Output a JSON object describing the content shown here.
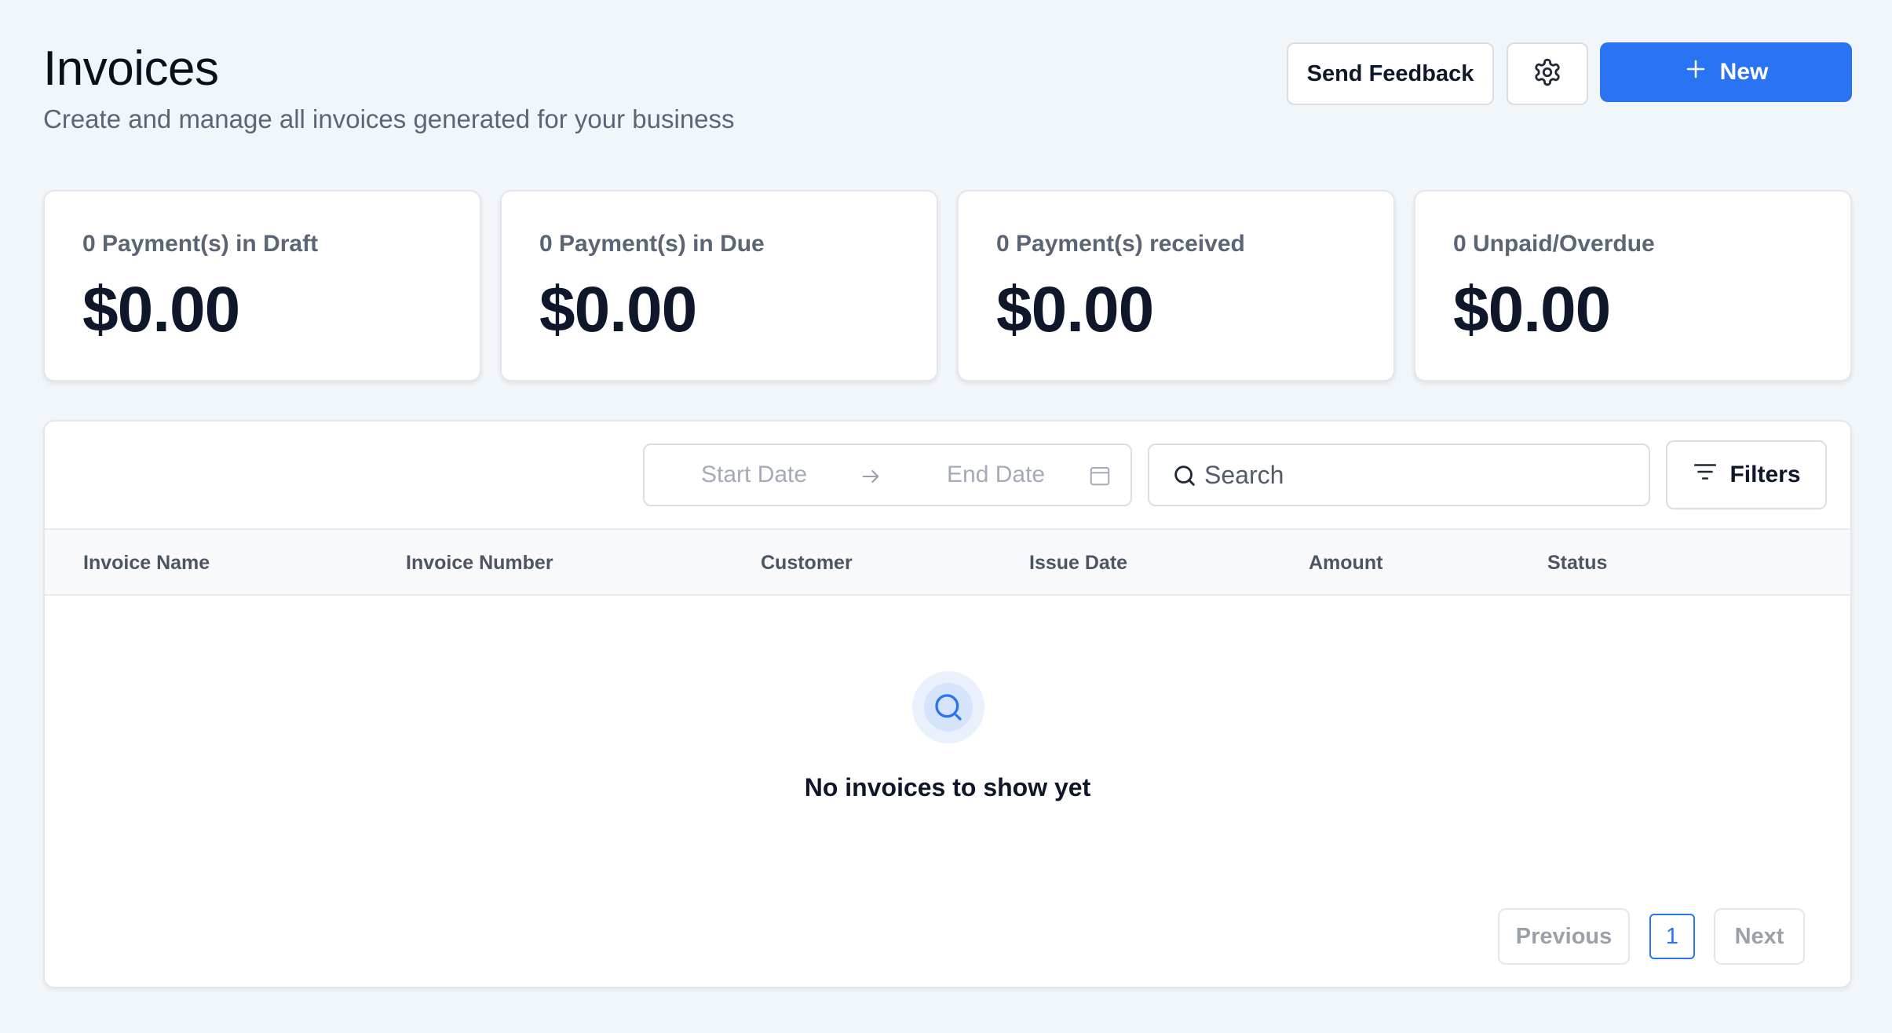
{
  "header": {
    "title": "Invoices",
    "subtitle": "Create and manage all invoices generated for your business",
    "feedback_label": "Send Feedback",
    "settings_icon": "gear-icon",
    "new_label": "New"
  },
  "stats": [
    {
      "label": "0 Payment(s) in Draft",
      "value": "$0.00"
    },
    {
      "label": "0 Payment(s) in Due",
      "value": "$0.00"
    },
    {
      "label": "0 Payment(s) received",
      "value": "$0.00"
    },
    {
      "label": "0 Unpaid/Overdue",
      "value": "$0.00"
    }
  ],
  "toolbar": {
    "start_date_placeholder": "Start Date",
    "end_date_placeholder": "End Date",
    "search_placeholder": "Search",
    "filters_label": "Filters"
  },
  "table": {
    "columns": [
      "Invoice Name",
      "Invoice Number",
      "Customer",
      "Issue Date",
      "Amount",
      "Status"
    ],
    "empty_text": "No invoices to show yet"
  },
  "pagination": {
    "previous_label": "Previous",
    "current_page": "1",
    "next_label": "Next"
  },
  "colors": {
    "accent": "#2a73f2",
    "background": "#f1f6fa"
  }
}
